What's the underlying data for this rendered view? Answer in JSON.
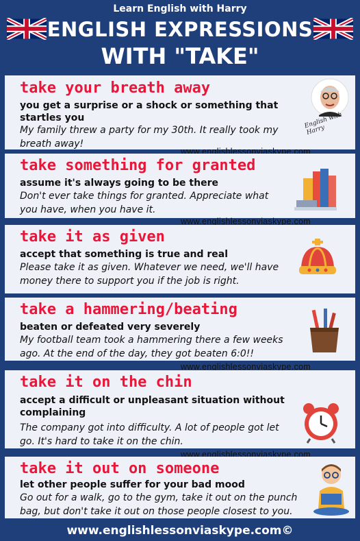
{
  "header": {
    "subtitle": "Learn English with Harry",
    "title_line1": "ENGLISH EXPRESSIONS",
    "title_line2": "WITH \"TAKE\"",
    "signature": "English with Harry"
  },
  "website": "www.englishlessonviaskype.com",
  "expressions": [
    {
      "phrase": "take your breath away",
      "meaning": "you get a surprise or a shock or something that startles you",
      "example": "My family threw a party for my 30th. It really took my breath away!",
      "icon": "harry-portrait-icon"
    },
    {
      "phrase": "take something for granted",
      "meaning": "assume it's always going to be there",
      "example": "Don't ever take things for granted. Appreciate what you have, when you have it.",
      "icon": "books-icon"
    },
    {
      "phrase": "take it as given",
      "meaning": "accept that something is true and real",
      "example": "Please take it as given. Whatever we need, we'll have money there to support you if the job is right.",
      "icon": "crown-icon"
    },
    {
      "phrase": "take a hammering/beating",
      "meaning": "beaten or defeated very severely",
      "example": "My football team took a hammering there a few weeks ago. At the end of the day, they got beaten 6:0!!",
      "icon": "pencil-cup-icon"
    },
    {
      "phrase": "take it on the chin",
      "meaning": "accept a difficult or unpleasant situation without complaining",
      "example": "The company got into difficulty. A lot of people got let go. It's hard to take it on the chin.",
      "icon": "alarm-clock-icon"
    },
    {
      "phrase": "take it out on someone",
      "meaning": "let other people suffer for your bad mood",
      "example": "Go out for a walk, go to the gym, take it out on the punch bag, but don't take it out on those people closest to you.",
      "icon": "reading-boy-icon"
    }
  ],
  "footer": "www.englishlessonviaskype.com©",
  "colors": {
    "background": "#1f3f7a",
    "phrase": "#e8173a",
    "card": "#eef1f8"
  }
}
